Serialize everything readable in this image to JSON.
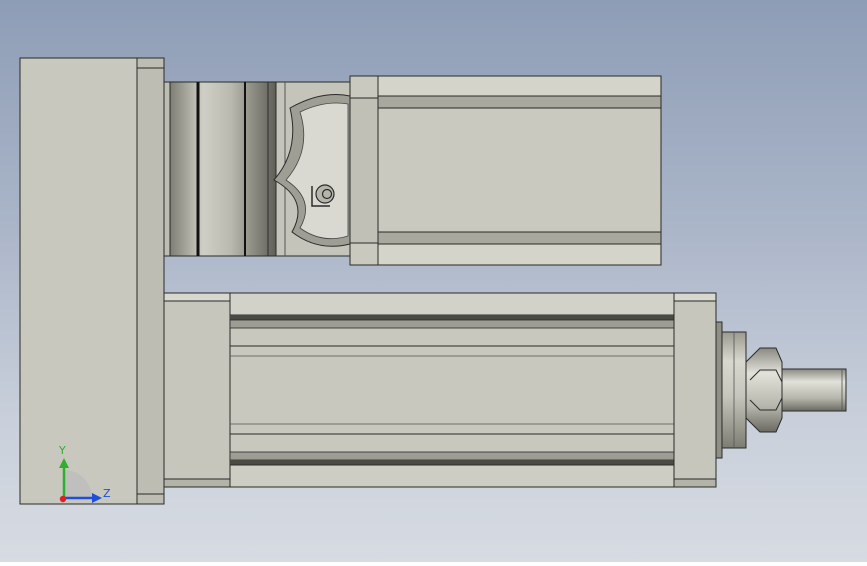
{
  "triad": {
    "y_label": "Y",
    "z_label": "Z",
    "colors": {
      "y": "#2fae2f",
      "z": "#1f4fd8",
      "x": "#e02020"
    }
  },
  "palette": {
    "background_top": "#8e9db6",
    "background_bottom": "#d7dbe2",
    "body": "#c9c9bf",
    "edge": "#2a2a2a"
  }
}
